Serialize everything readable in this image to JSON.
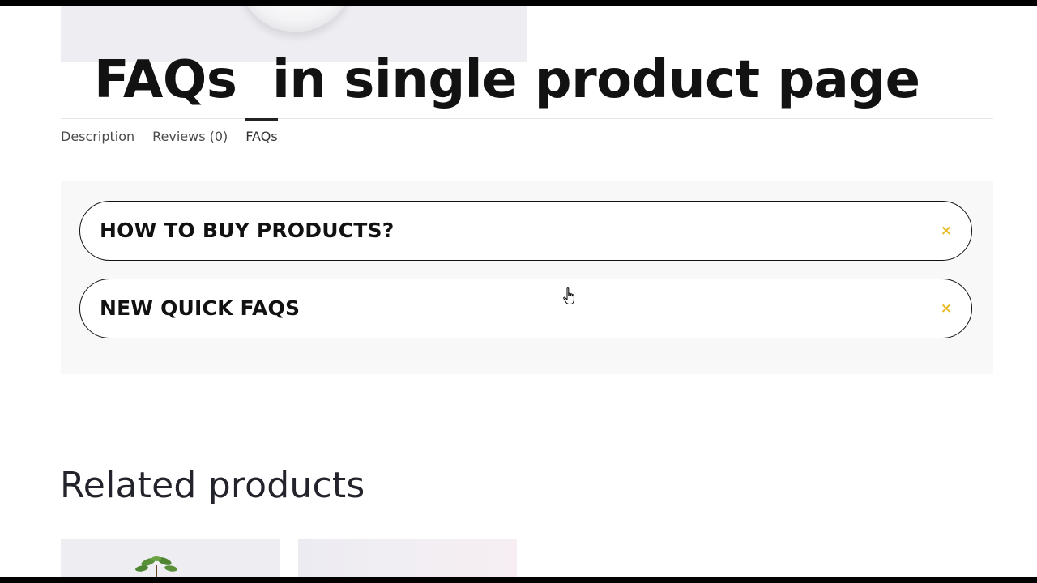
{
  "overlay_title": "FAQs  in single product page",
  "tabs": [
    {
      "label": "Description",
      "active": false
    },
    {
      "label": "Reviews (0)",
      "active": false
    },
    {
      "label": "FAQs",
      "active": true
    }
  ],
  "faqs": [
    {
      "question": "HOW TO BUY PRODUCTS?",
      "toggle_icon": "×"
    },
    {
      "question": "NEW QUICK FAQS",
      "toggle_icon": "×"
    }
  ],
  "related": {
    "title": "Related products"
  },
  "colors": {
    "accent": "#e8b923",
    "text": "#111111",
    "panel_bg": "#f8f8f8"
  }
}
